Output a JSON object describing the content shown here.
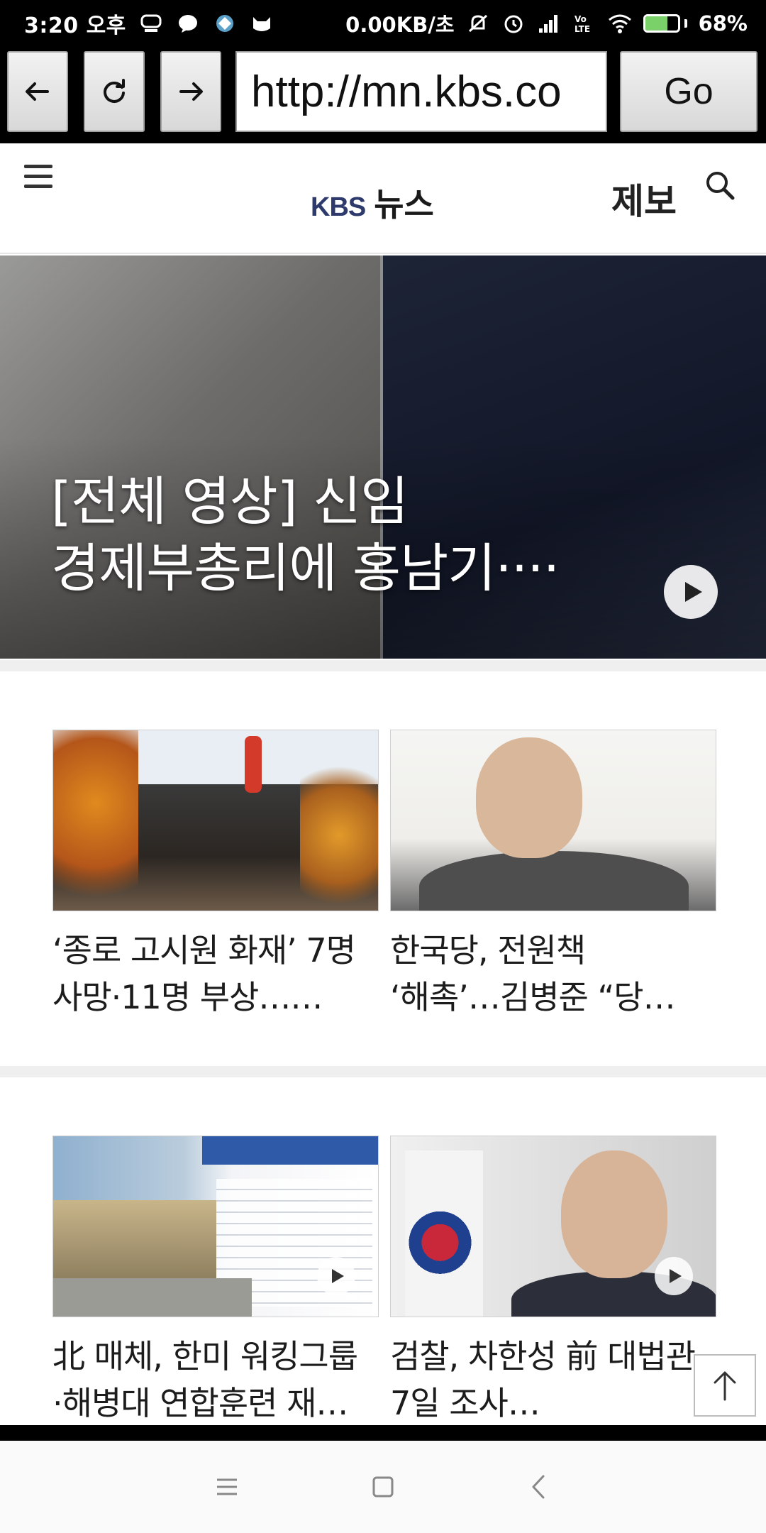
{
  "status_bar": {
    "time": "3:20 오후",
    "network_speed": "0.00KB/초",
    "battery_percent": "68%",
    "battery_level": 0.68,
    "icons": [
      "notification-icon",
      "chat-bubble-icon",
      "app-icon",
      "cat-icon",
      "mute-icon",
      "alarm-icon",
      "signal-icon",
      "volte-icon",
      "wifi-icon",
      "battery-charging-icon"
    ]
  },
  "browser": {
    "back_icon": "arrow-left-icon",
    "reload_icon": "reload-icon",
    "forward_icon": "arrow-right-icon",
    "url": "http://mn.kbs.co",
    "go_label": "Go"
  },
  "site_header": {
    "logo_kbs": "KBS",
    "logo_news": "뉴스",
    "tip_label": "제보",
    "brand_color": "#2d3a6b"
  },
  "hero": {
    "title_line1": "[전체 영상] 신임",
    "title_line2": "경제부총리에 홍남기····"
  },
  "articles": [
    {
      "title_line1": "‘종로 고시원 화재’ 7명",
      "title_line2": "사망·11명 부상……",
      "has_video": false
    },
    {
      "title_line1": "한국당, 전원책",
      "title_line2": "‘해촉’…김병준 “당…",
      "has_video": false
    },
    {
      "title_line1": "北 매체, 한미 워킹그룹",
      "title_line2": "·해병대 연합훈련 재…",
      "has_video": true
    },
    {
      "title_line1": "검찰, 차한성 前 대법관",
      "title_line2": "7일 조사…",
      "has_video": true
    }
  ],
  "nav_bar": {
    "icons": [
      "menu-icon",
      "home-square-icon",
      "back-chevron-icon"
    ]
  }
}
